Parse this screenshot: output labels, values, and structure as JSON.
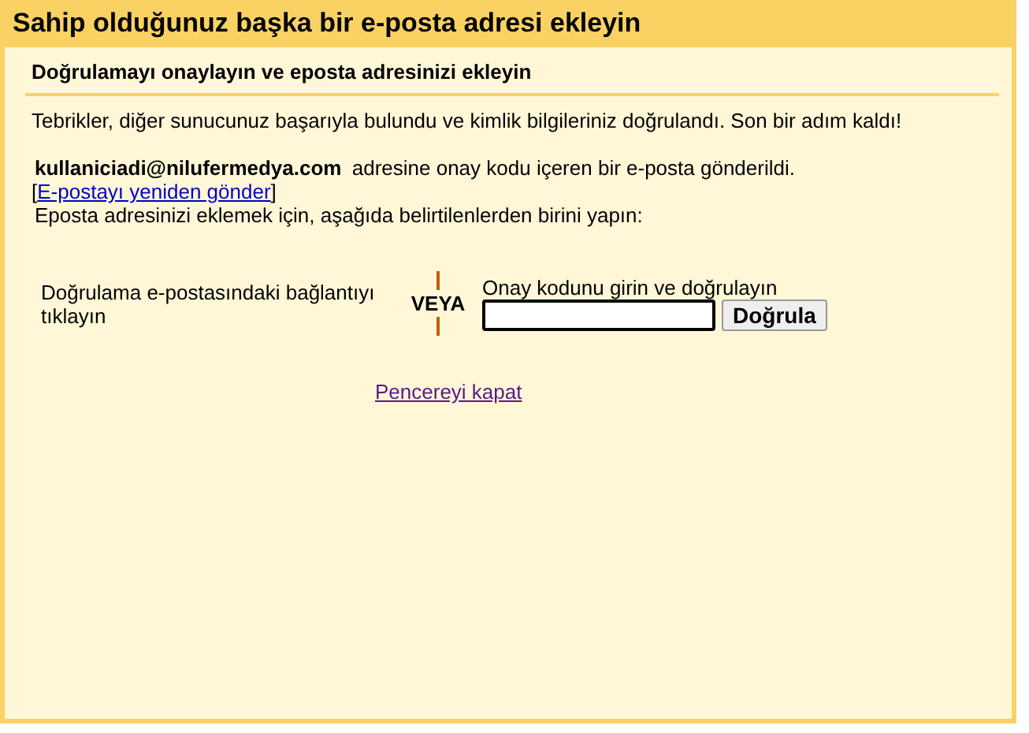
{
  "window": {
    "title": "Sahip olduğunuz başka bir e-posta adresi ekleyin"
  },
  "section_title": "Doğrulamayı onaylayın ve eposta adresinizi ekleyin",
  "message": "Tebrikler, diğer sunucunuz başarıyla bulundu ve kimlik bilgileriniz doğrulandı. Son bir adım kaldı!",
  "sent_notice": {
    "email": "kullaniciadi@nilufermedya.com",
    "text": "adresine onay kodu içeren bir e-posta gönderildi.",
    "resend_open": "[",
    "resend_link": "E-postayı yeniden gönder",
    "resend_close": "]"
  },
  "instruction": "Eposta adresinizi eklemek için, aşağıda belirtilenlerden birini yapın:",
  "option_link": "Doğrulama e-postasındaki bağlantıyı tıklayın",
  "separator": "VEYA",
  "option_code": {
    "label": "Onay kodunu girin ve doğrulayın",
    "button": "Doğrula"
  },
  "close_link": "Pencereyi kapat"
}
